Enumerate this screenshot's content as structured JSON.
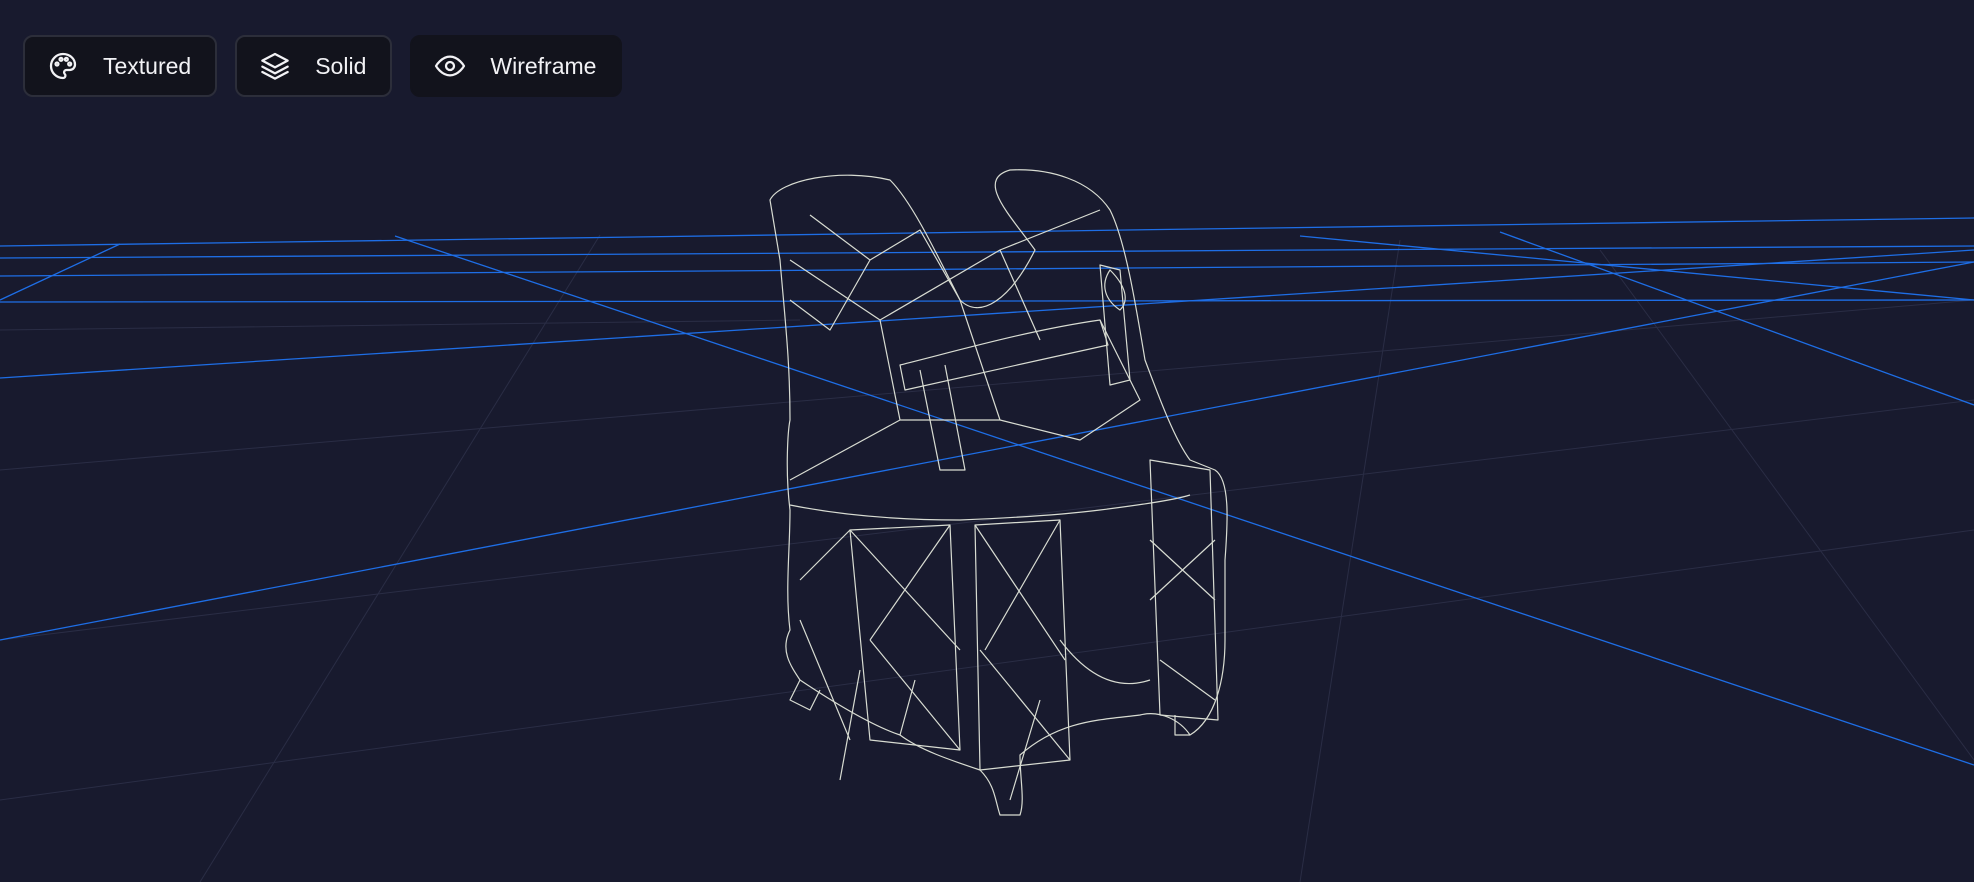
{
  "viewer": {
    "background_color": "#181a2e",
    "grid_color": "#1e6ee6",
    "minor_grid_color": "#2a2d45",
    "model": "tactical-vest",
    "model_color": "#d8dcd2",
    "render_mode": "Wireframe"
  },
  "toolbar": {
    "buttons": [
      {
        "label": "Textured",
        "icon": "palette-icon"
      },
      {
        "label": "Solid",
        "icon": "layers-icon"
      },
      {
        "label": "Wireframe",
        "icon": "eye-icon"
      }
    ]
  }
}
